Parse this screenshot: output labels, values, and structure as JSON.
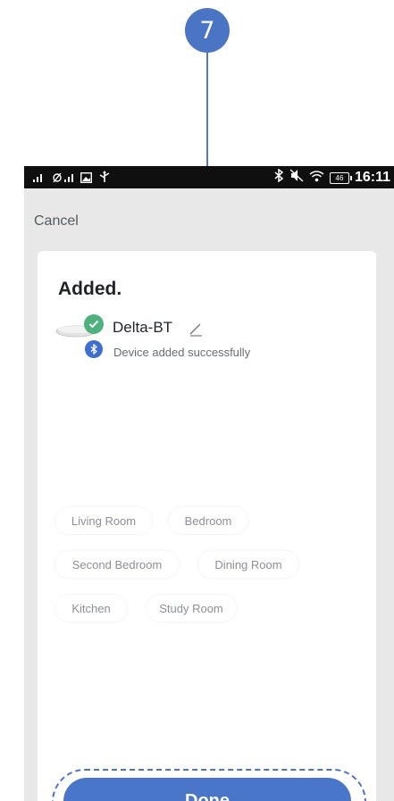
{
  "step": {
    "number": "7",
    "color": "#4a74c4"
  },
  "status_bar": {
    "time": "16:11",
    "battery": "46",
    "left_icons": [
      "signal-icon",
      "signal-icon",
      "image-icon",
      "usb-icon"
    ],
    "right_icons": [
      "bluetooth-icon",
      "mute-icon",
      "wifi-icon",
      "battery-icon"
    ]
  },
  "nav": {
    "cancel_label": "Cancel"
  },
  "card": {
    "title": "Added.",
    "device": {
      "name": "Delta-BT",
      "status": "Device added successfully",
      "check_color": "#4fb17d",
      "bluetooth_color": "#3f6ed1"
    },
    "rooms": [
      "Living Room",
      "Bedroom",
      "Second Bedroom",
      "Dining Room",
      "Kitchen",
      "Study Room"
    ],
    "done_label": "Done",
    "accent": "#4a76c9"
  }
}
